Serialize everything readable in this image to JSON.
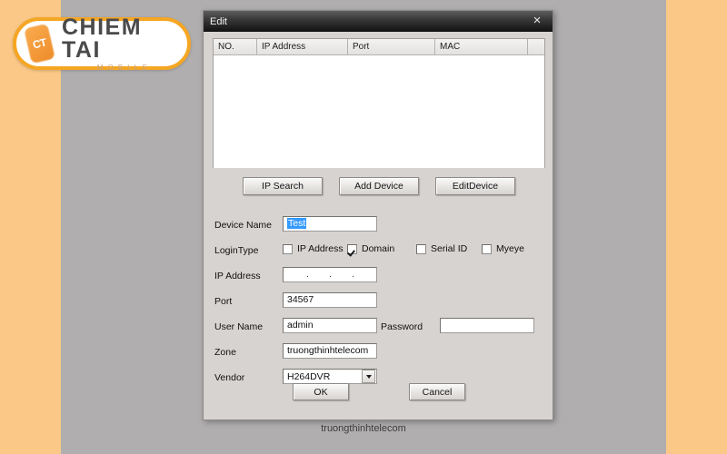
{
  "page": {
    "background_color": "#b0aeae",
    "band_color": "#fbc888",
    "watermark": "truongthinhtelecom"
  },
  "logo": {
    "badge_ct": "CT",
    "wordmark_main": "CHIEM TAI",
    "wordmark_sub": "MOBILE",
    "accent_color": "#f5a623"
  },
  "dialog": {
    "title": "Edit",
    "close_label": "×",
    "accent_selection_color": "#3399ff"
  },
  "device_list": {
    "columns": [
      "NO.",
      "IP Address",
      "Port",
      "MAC",
      ""
    ],
    "rows": []
  },
  "actions": [
    {
      "label": "IP Search"
    },
    {
      "label": "Add Device"
    },
    {
      "label": "EditDevice"
    }
  ],
  "form": {
    "device_name": {
      "label": "Device Name",
      "value": "Test",
      "placeholder": ""
    },
    "login_type": {
      "label": "LoginType",
      "options": [
        {
          "label": "IP Address",
          "checked": false
        },
        {
          "label": "Domain",
          "checked": true
        },
        {
          "label": "Serial ID",
          "checked": false
        },
        {
          "label": "Myeye",
          "checked": false
        }
      ]
    },
    "ip_address": {
      "label": "IP Address",
      "octets": [
        ".",
        ".",
        "."
      ],
      "value": "",
      "placeholder": ""
    },
    "port": {
      "label": "Port",
      "value": "34567",
      "placeholder": ""
    },
    "user_name": {
      "label": "User Name",
      "value": "admin",
      "placeholder": ""
    },
    "password": {
      "label": "Password",
      "value": "",
      "placeholder": ""
    },
    "zone": {
      "label": "Zone",
      "value": "truongthinhtelecom",
      "placeholder": ""
    },
    "vendor": {
      "label": "Vendor",
      "value": "H264DVR",
      "options": [
        "H264DVR"
      ]
    }
  },
  "footer": {
    "ok_label": "OK",
    "cancel_label": "Cancel"
  }
}
